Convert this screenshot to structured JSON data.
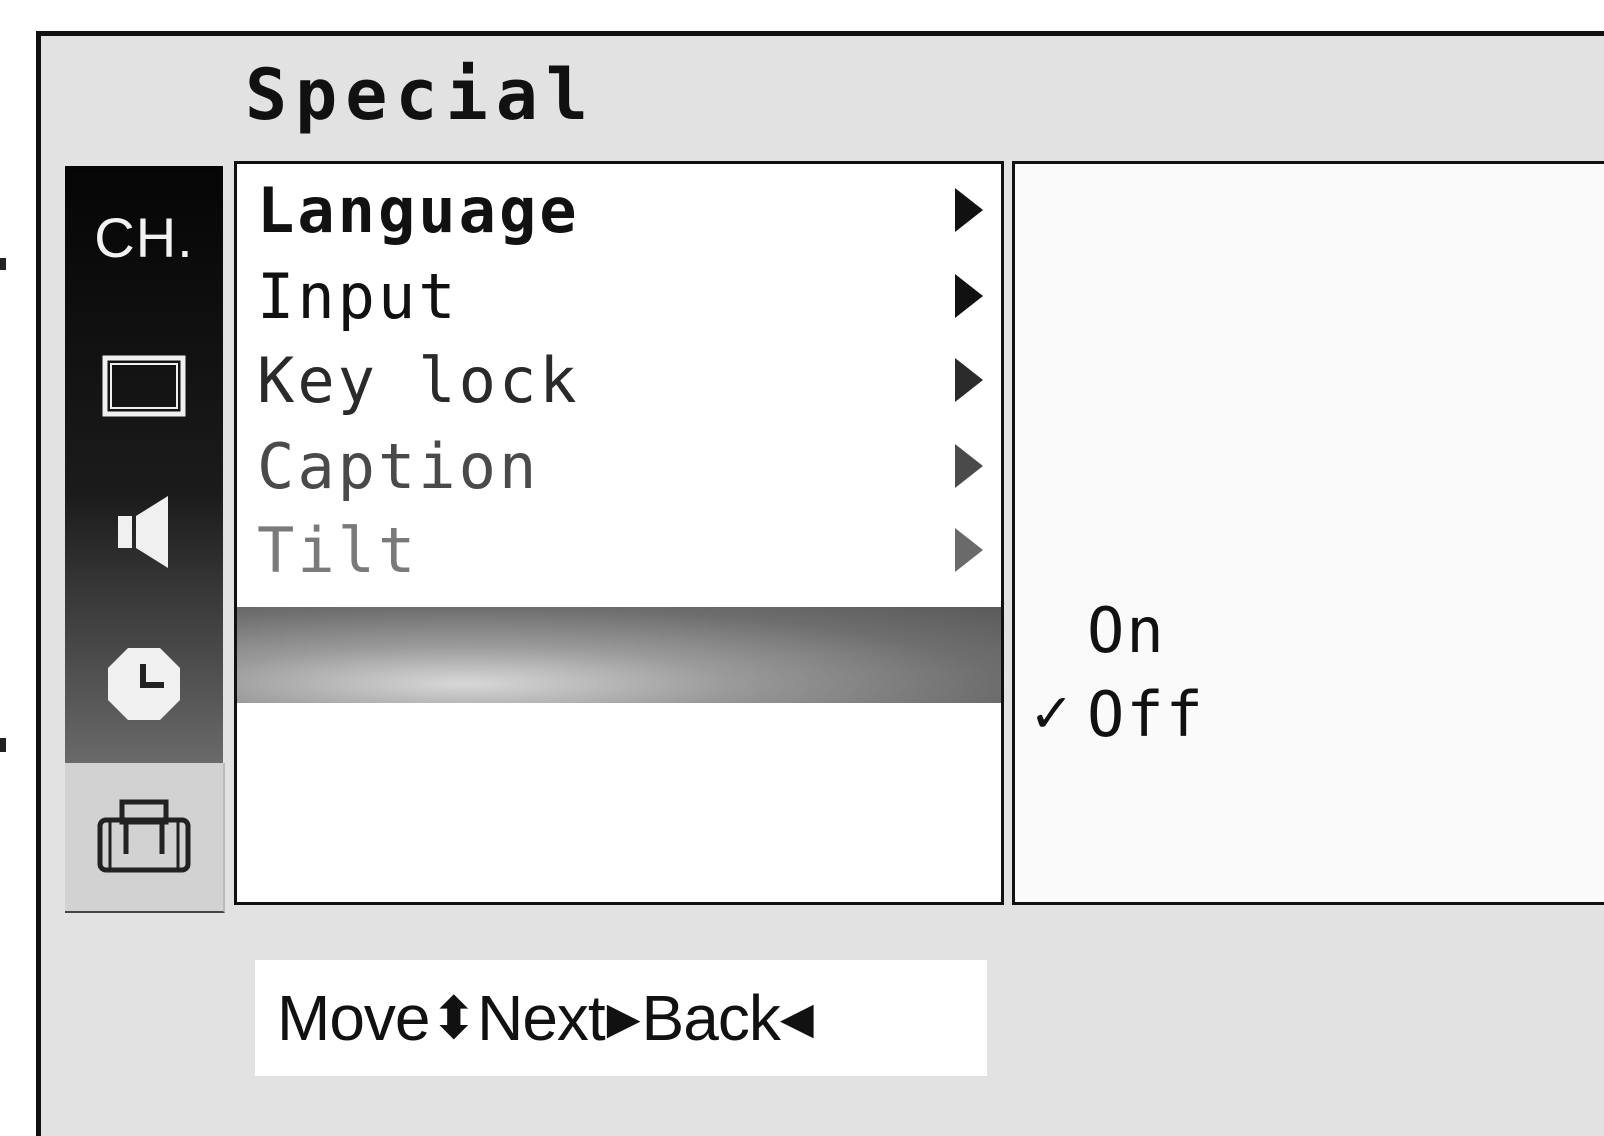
{
  "title": "Special",
  "sidebar": [
    {
      "name": "channel",
      "label": "CH.",
      "icon": "channel-text-icon"
    },
    {
      "name": "picture",
      "icon": "screen-icon"
    },
    {
      "name": "sound",
      "icon": "speaker-icon"
    },
    {
      "name": "time",
      "icon": "clock-icon"
    },
    {
      "name": "special",
      "icon": "toolbox-icon",
      "selected": true
    }
  ],
  "menu": {
    "items": [
      {
        "label": "Language",
        "color": "#111111"
      },
      {
        "label": "Input",
        "color": "#111111"
      },
      {
        "label": "Key lock",
        "color": "#2a2a2a"
      },
      {
        "label": "Caption",
        "color": "#4a4a4a"
      },
      {
        "label": "Tilt",
        "color": "#7a7a7a"
      }
    ]
  },
  "options": {
    "items": [
      {
        "label": "On",
        "checked": false
      },
      {
        "label": "Off",
        "checked": true
      }
    ],
    "check_glyph": "✓"
  },
  "hint": {
    "move_label": "Move",
    "move_glyph": "⬍",
    "next_label": "Next",
    "next_glyph": "▶",
    "back_label": "Back",
    "back_glyph": "◀"
  },
  "colors": {
    "frame_bg": "#e2e2e2",
    "sidebar_dark": "#111111",
    "highlight": "#7a7a7a"
  }
}
